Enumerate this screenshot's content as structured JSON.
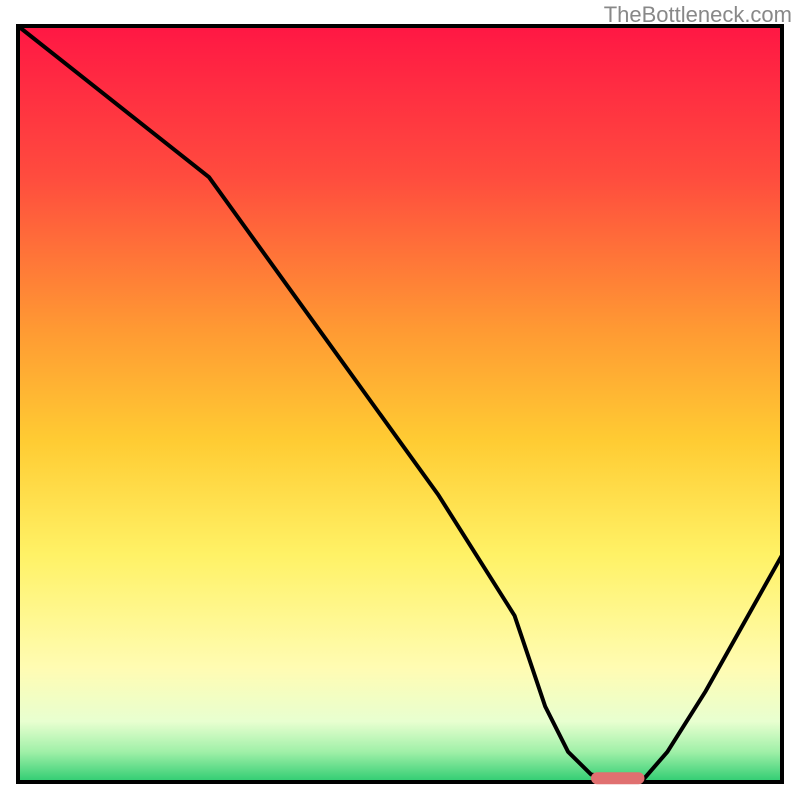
{
  "watermark": "TheBottleneck.com",
  "chart_data": {
    "type": "line",
    "title": "",
    "xlabel": "",
    "ylabel": "",
    "xlim": [
      0,
      100
    ],
    "ylim": [
      0,
      100
    ],
    "x": [
      0,
      5,
      10,
      15,
      20,
      25,
      30,
      35,
      40,
      45,
      50,
      55,
      60,
      65,
      69,
      72,
      75,
      78,
      82,
      85,
      90,
      95,
      100
    ],
    "values": [
      100,
      96,
      92,
      88,
      84,
      80,
      73,
      66,
      59,
      52,
      45,
      38,
      30,
      22,
      10,
      4,
      1,
      0.5,
      0.5,
      4,
      12,
      21,
      30
    ],
    "marker": {
      "x_range": [
        75,
        82
      ],
      "y": 0.5,
      "color": "#e07070"
    },
    "background_gradient": {
      "stops": [
        {
          "offset": 0,
          "color": "#ff1744"
        },
        {
          "offset": 20,
          "color": "#ff4c3e"
        },
        {
          "offset": 40,
          "color": "#ff9933"
        },
        {
          "offset": 55,
          "color": "#ffcc33"
        },
        {
          "offset": 70,
          "color": "#fff266"
        },
        {
          "offset": 85,
          "color": "#fffcb3"
        },
        {
          "offset": 92,
          "color": "#e8ffd0"
        },
        {
          "offset": 96,
          "color": "#a0f0a8"
        },
        {
          "offset": 100,
          "color": "#2ecc71"
        }
      ]
    },
    "border_color": "#000000",
    "line_color": "#000000"
  }
}
